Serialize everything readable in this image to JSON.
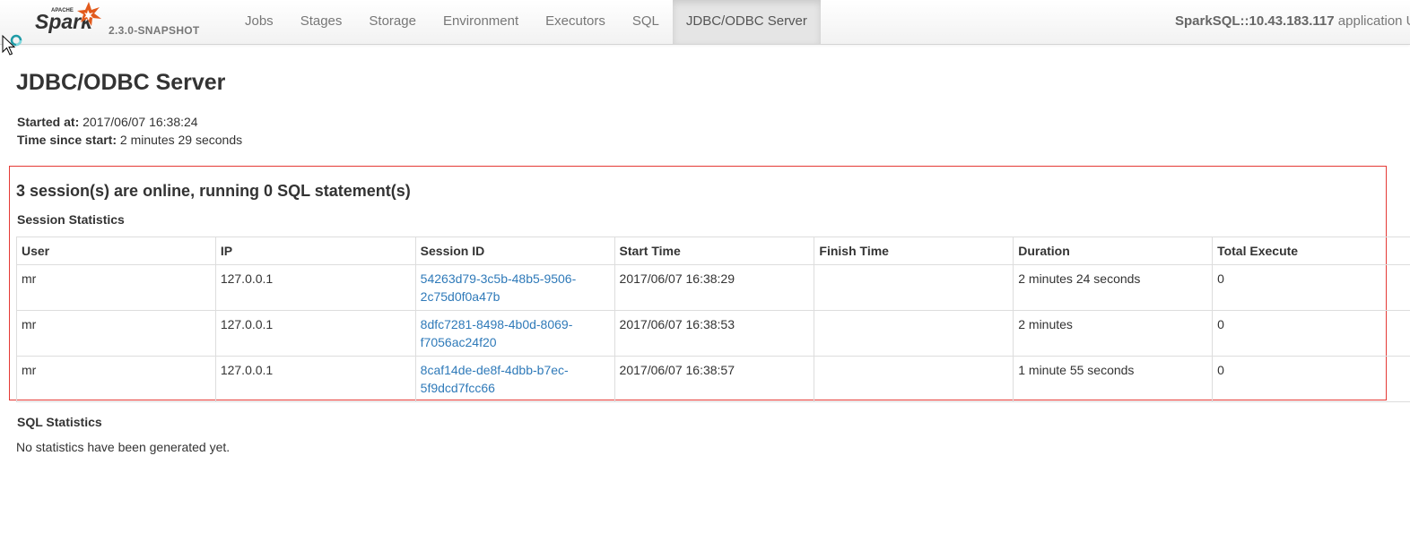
{
  "navbar": {
    "brand": {
      "logo_small_text": "APACHE",
      "logo_text": "Spark",
      "version": "2.3.0-SNAPSHOT"
    },
    "tabs": [
      {
        "label": "Jobs",
        "active": false
      },
      {
        "label": "Stages",
        "active": false
      },
      {
        "label": "Storage",
        "active": false
      },
      {
        "label": "Environment",
        "active": false
      },
      {
        "label": "Executors",
        "active": false
      },
      {
        "label": "SQL",
        "active": false
      },
      {
        "label": "JDBC/ODBC Server",
        "active": true
      }
    ],
    "app_name": "SparkSQL::10.43.183.117",
    "app_suffix": " application U"
  },
  "page": {
    "title": "JDBC/ODBC Server",
    "started_at_label": "Started at:",
    "started_at_value": "2017/06/07 16:38:24",
    "time_since_label": "Time since start:",
    "time_since_value": "2 minutes 29 seconds"
  },
  "sessions": {
    "heading": "3 session(s) are online, running 0 SQL statement(s)",
    "section_title": "Session Statistics",
    "columns": [
      "User",
      "IP",
      "Session ID",
      "Start Time",
      "Finish Time",
      "Duration",
      "Total Execute"
    ],
    "rows": [
      {
        "user": "mr",
        "ip": "127.0.0.1",
        "session_id_1": "54263d79-3c5b-48b5-9506-",
        "session_id_2": "2c75d0f0a47b",
        "start_time": "2017/06/07 16:38:29",
        "finish_time": "",
        "duration": "2 minutes 24 seconds",
        "total_execute": "0"
      },
      {
        "user": "mr",
        "ip": "127.0.0.1",
        "session_id_1": "8dfc7281-8498-4b0d-8069-",
        "session_id_2": "f7056ac24f20",
        "start_time": "2017/06/07 16:38:53",
        "finish_time": "",
        "duration": "2 minutes",
        "total_execute": "0"
      },
      {
        "user": "mr",
        "ip": "127.0.0.1",
        "session_id_1": "8caf14de-de8f-4dbb-b7ec-",
        "session_id_2": "5f9dcd7fcc66",
        "start_time": "2017/06/07 16:38:57",
        "finish_time": "",
        "duration": "1 minute 55 seconds",
        "total_execute": "0"
      }
    ]
  },
  "sql_stats": {
    "section_title": "SQL Statistics",
    "empty_message": "No statistics have been generated yet."
  },
  "colors": {
    "link": "#2f7ab9",
    "highlight_border": "#e53935",
    "spark_orange": "#e25a1c",
    "cursor_icon": "mouse-pointer-icon",
    "busy_icon": "loading-ring-icon"
  }
}
